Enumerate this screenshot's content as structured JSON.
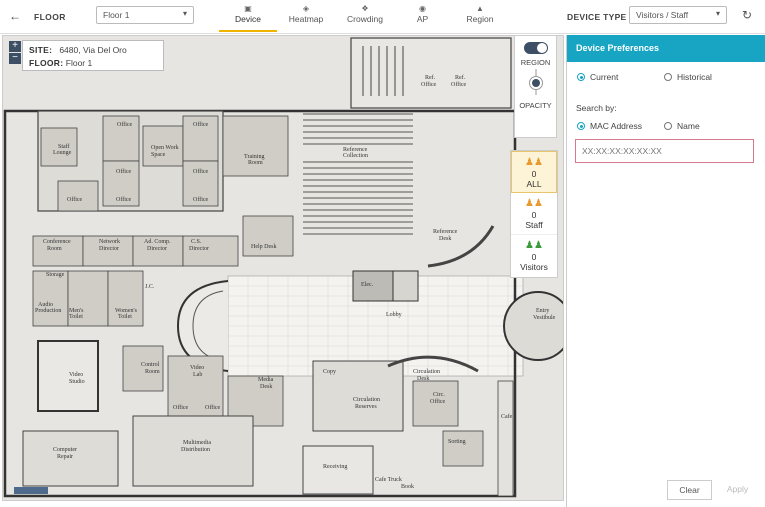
{
  "header": {
    "floor_label": "FLOOR",
    "floor_value": "Floor 1",
    "tabs": [
      {
        "label": "Device",
        "icon": "device-icon",
        "active": true
      },
      {
        "label": "Heatmap",
        "icon": "heatmap-icon",
        "active": false
      },
      {
        "label": "Crowding",
        "icon": "crowding-icon",
        "active": false
      },
      {
        "label": "AP",
        "icon": "wifi-icon",
        "active": false
      },
      {
        "label": "Region",
        "icon": "region-icon",
        "active": false
      }
    ],
    "device_type_label": "DEVICE TYPE",
    "device_type_value": "Visitors / Staff"
  },
  "map": {
    "site_label": "SITE:",
    "site_value": "6480, Via Del Oro",
    "floor_label": "FLOOR:",
    "floor_value": "Floor 1",
    "zoom_in": "+",
    "zoom_out": "−",
    "region_label": "REGION",
    "opacity_label": "OPACITY",
    "counts": [
      {
        "value": "0",
        "label": "ALL",
        "color": "#e89a2f"
      },
      {
        "value": "0",
        "label": "Staff",
        "color": "#e89a2f"
      },
      {
        "value": "0",
        "label": "Visitors",
        "color": "#3a9b3a"
      }
    ],
    "rooms": [
      "Office",
      "Office",
      "Open Work Space",
      "Office",
      "Staff Lounge",
      "Office",
      "Office",
      "Office",
      "Office",
      "Training Room",
      "Reference Collection",
      "Ref. Office",
      "Ref. Office",
      "Conference Room",
      "Network Director",
      "Ad. Comp. Director",
      "C.S. Director",
      "Help Desk",
      "Reference Desk",
      "Storage",
      "Audio Production Room",
      "Men's Toilet",
      "Women's Toilet",
      "J.C.",
      "Elec.",
      "Lobby",
      "Entry Vestibule",
      "Video Studio",
      "Control Room",
      "Video Lab",
      "Media Desk",
      "Office",
      "Office",
      "Copy",
      "Circulation Desk",
      "Circulation Reserves",
      "Circ. Office",
      "Computer Repair",
      "Multimedia Distribution",
      "Receiving",
      "Sorting",
      "Cafe",
      "Cafe Truck Storage",
      "Book Return"
    ]
  },
  "prefs": {
    "title": "Device Preferences",
    "mode_current": "Current",
    "mode_historical": "Historical",
    "search_by_label": "Search by:",
    "search_mac": "MAC Address",
    "search_name": "Name",
    "mac_placeholder": "XX:XX:XX:XX:XX:XX",
    "clear_label": "Clear",
    "apply_label": "Apply",
    "accent_color": "#17a5c3"
  }
}
